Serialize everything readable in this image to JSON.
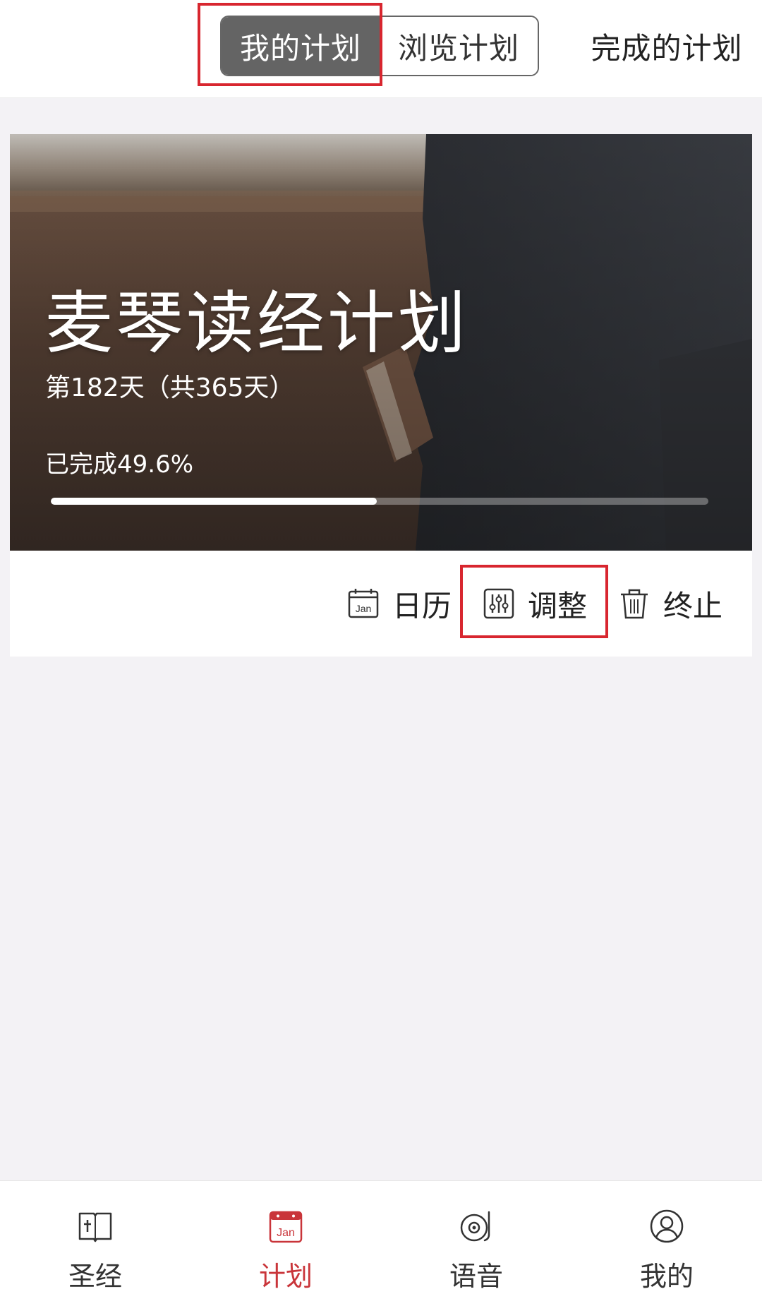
{
  "top_tabs": {
    "segmented": [
      {
        "label": "我的计划",
        "active": true
      },
      {
        "label": "浏览计划",
        "active": false
      }
    ],
    "completed_label": "完成的计划"
  },
  "plan_card": {
    "title": "麦琴读经计划",
    "day_text": "第182天（共365天）",
    "progress_text": "已完成49.6%",
    "progress_fraction": 0.496,
    "actions": {
      "calendar": {
        "label": "日历",
        "icon": "calendar-icon",
        "icon_text": "Jan"
      },
      "adjust": {
        "label": "调整",
        "icon": "sliders-icon"
      },
      "stop": {
        "label": "终止",
        "icon": "trash-icon"
      }
    }
  },
  "bottom_nav": {
    "items": [
      {
        "label": "圣经",
        "icon": "bible-book-icon",
        "active": false
      },
      {
        "label": "计划",
        "icon": "calendar-icon",
        "icon_text": "Jan",
        "active": true
      },
      {
        "label": "语音",
        "icon": "audio-disc-icon",
        "active": false
      },
      {
        "label": "我的",
        "icon": "profile-icon",
        "active": false
      }
    ]
  },
  "colors": {
    "accent_red": "#c9353a",
    "highlight_red": "#d8262f",
    "segment_active_bg": "#646464",
    "page_bg": "#f3f2f5"
  }
}
